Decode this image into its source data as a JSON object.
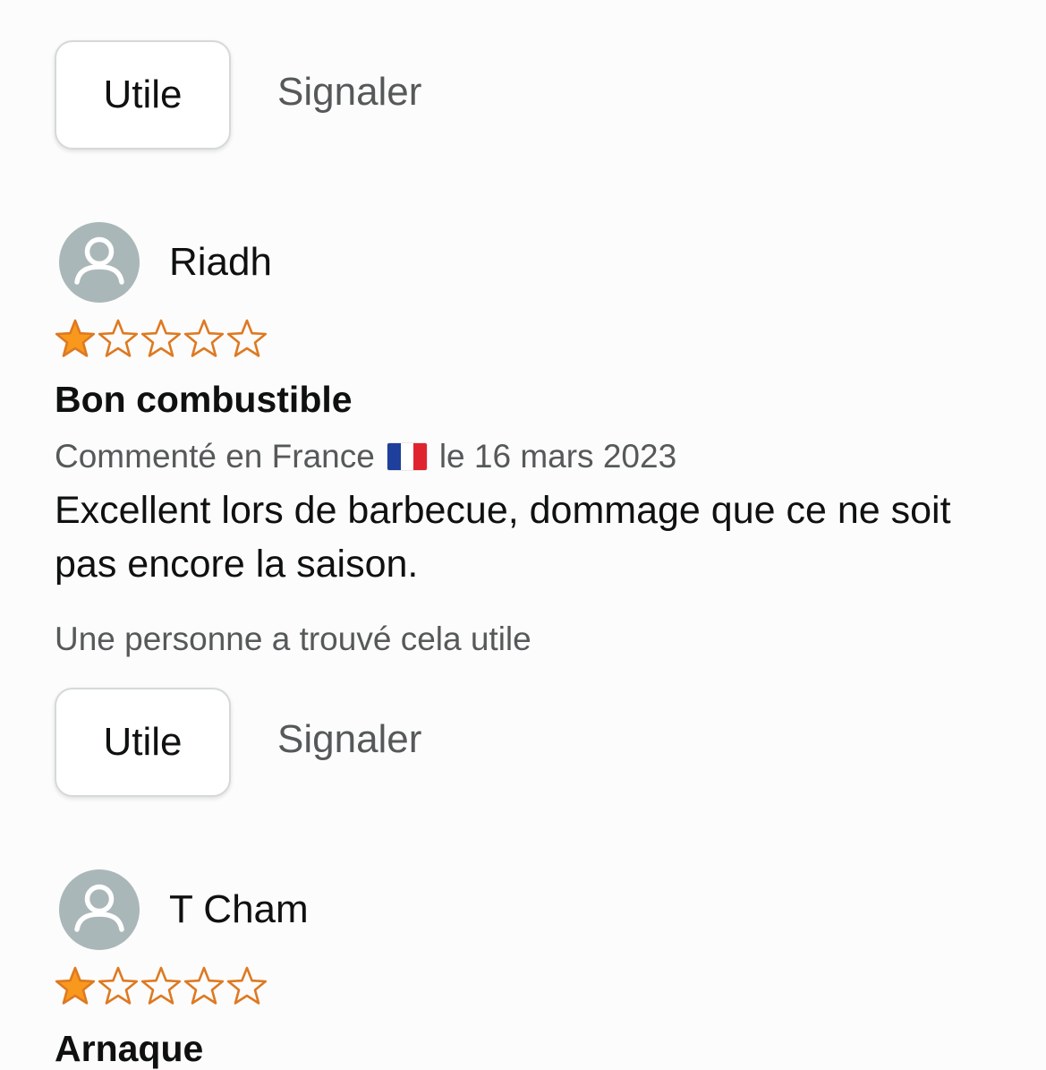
{
  "buttons": {
    "helpful_label": "Utile",
    "report_label": "Signaler"
  },
  "reviews": [
    {
      "reviewer": "Riadh",
      "rating": 1,
      "max_rating": 5,
      "title": "Bon combustible",
      "meta_prefix": "Commenté en France",
      "country_flag": "france-flag-icon",
      "meta_suffix": "le 16 mars 2023",
      "body": "Excellent lors de barbecue, dommage que ce ne soit pas encore la saison.",
      "helpful_count": "Une personne a trouvé cela utile"
    },
    {
      "reviewer": "T Cham",
      "rating": 1,
      "max_rating": 5,
      "title": "Arnaque"
    }
  ],
  "colors": {
    "star_fill": "#f8991d",
    "star_outline": "#de7921",
    "avatar_bg": "#aab7b8",
    "secondary_text": "#565959"
  }
}
